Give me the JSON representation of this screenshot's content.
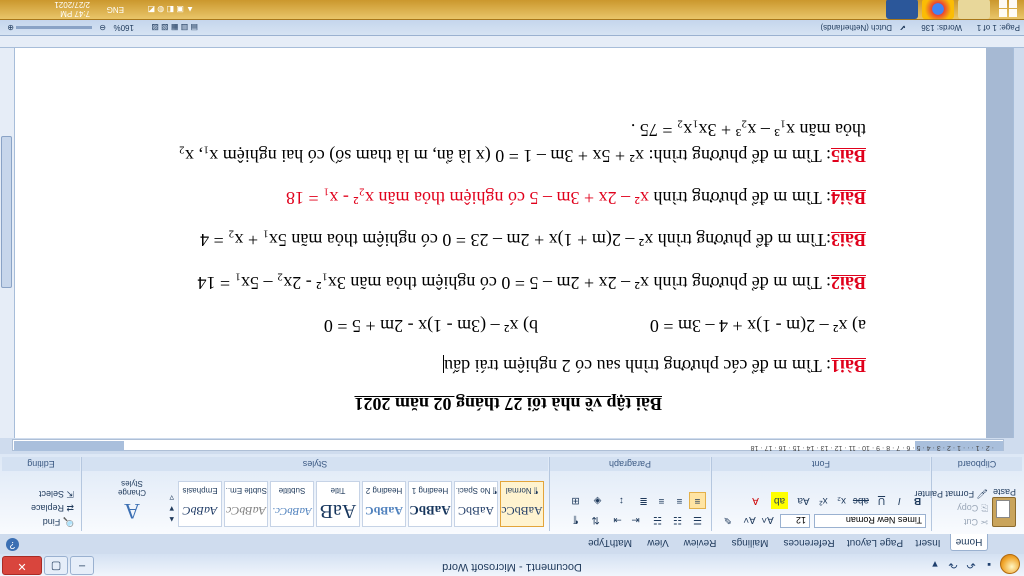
{
  "app": {
    "title": "Document1 - Microsoft Word",
    "window_buttons": {
      "minimize": "–",
      "restore": "▢",
      "close": "✕"
    }
  },
  "ribbon": {
    "tabs": [
      "Home",
      "Insert",
      "Page Layout",
      "References",
      "Mailings",
      "Review",
      "View",
      "MathType"
    ],
    "active_tab": "Home",
    "clipboard": {
      "paste": "Paste",
      "cut": "Cut",
      "copy": "Copy",
      "format_painter": "Format Painter",
      "label": "Clipboard"
    },
    "font": {
      "name": "Times New Roman",
      "size": "12",
      "label": "Font"
    },
    "paragraph": {
      "label": "Paragraph"
    },
    "styles": {
      "label": "Styles",
      "items": [
        {
          "name": "¶ Normal",
          "preview": "AaBbCc"
        },
        {
          "name": "¶ No Spaci...",
          "preview": "AaBbC"
        },
        {
          "name": "Heading 1",
          "preview": "AaBbC"
        },
        {
          "name": "Heading 2",
          "preview": "AaBbC"
        },
        {
          "name": "Title",
          "preview": "AaB"
        },
        {
          "name": "Subtitle",
          "preview": "AaBbCc."
        },
        {
          "name": "Subtle Em...",
          "preview": "AaBbCc"
        },
        {
          "name": "Emphasis",
          "preview": "AaBbC"
        }
      ],
      "change_styles": "Change Styles"
    },
    "editing": {
      "find": "Find",
      "replace": "Replace",
      "select": "Select",
      "label": "Editing"
    }
  },
  "ruler": {
    "numbers": "· 2 · 1 · · · 1 · 2 · 3 · 4 · 5 · 6 · 7 · 8 · 9 · 10 · 11 · 12 · 13 · 14 · 15 · 16 · 17 · 18"
  },
  "document": {
    "heading": "Bài tập về nhà tối 27 tháng 02 năm 2021",
    "bai1_label": "Bài1",
    "bai1_text": ": Tìm m để các phương trình sau có 2 nghiệm trái dấu",
    "eq_a": "a) x² – 2(m - 1)x + 4 – 3m = 0",
    "eq_b": "b) x² – (3m - 1)x  - 2m + 5 = 0",
    "bai2_label": "Bài2",
    "bai2_text": ": Tìm m để phương trình  x² – 2x + 2m – 5 = 0 có nghiệm thỏa mãn 3x₁² - 2x₂ – 5x₁ = 14",
    "bai3_label": "Bài3",
    "bai3_text": ":Tìm m để phương trình x² – 2(m + 1)x + 2m – 23 = 0 có nghiệm  thỏa mãn 5x₁ + x₂ = 4",
    "bai4_label": "Bài4",
    "bai4_text": ": Tìm m để phương trình  ",
    "bai4_red": "x² – 2x + 3m – 5 có nghiệm thỏa mãn  x₂² - x₁ = 18",
    "bai5_label": "Bài5",
    "bai5_text": ": Tìm m để phương trình: x² + 5x + 3m – 1 = 0  (x là ẩn, m là tham số) có hai nghiệm x₁, x₂",
    "bai5_cont": "thỏa mãn x₁³ – x₂³ + 3x₁x₂ = 75 ."
  },
  "status": {
    "page": "Page: 1 of 1",
    "words": "Words: 136",
    "language": "Dutch (Netherlands)",
    "zoom": "160%"
  },
  "taskbar": {
    "time": "7:47 PM",
    "date": "2/27/2021",
    "lang": "ENG"
  },
  "colors": {
    "accent_red": "#e0001b",
    "ribbon_blue": "#cfdcee",
    "taskbar_gold": "#d9ab45"
  }
}
